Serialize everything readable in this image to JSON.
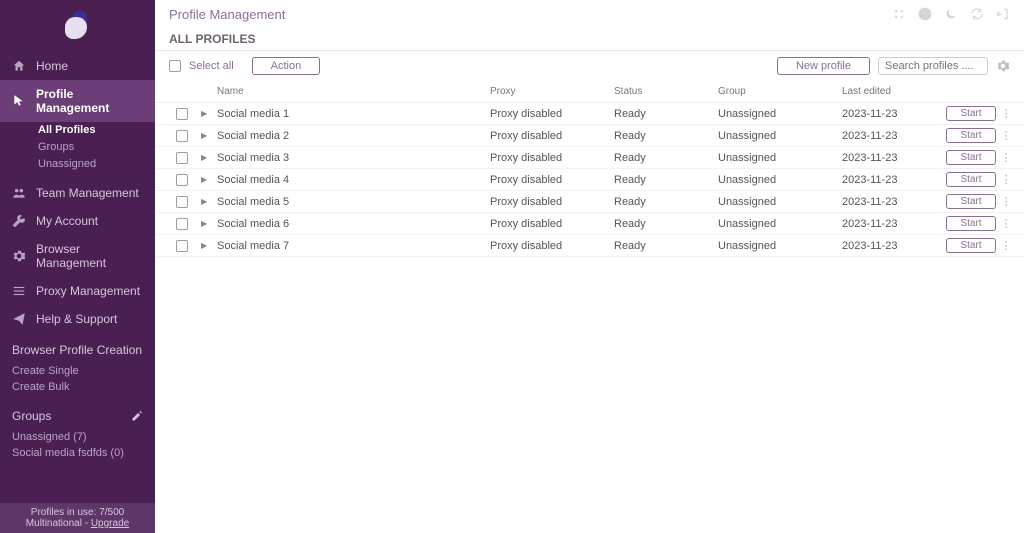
{
  "page_title": "Profile Management",
  "subheader": "ALL PROFILES",
  "toolbar": {
    "select_all": "Select all",
    "action": "Action",
    "new_profile": "New profile",
    "search_placeholder": "Search profiles ...."
  },
  "columns": {
    "name": "Name",
    "proxy": "Proxy",
    "status": "Status",
    "group": "Group",
    "last_edited": "Last edited"
  },
  "rows": [
    {
      "name": "Social media 1",
      "proxy": "Proxy disabled",
      "status": "Ready",
      "group": "Unassigned",
      "last_edited": "2023-11-23",
      "action": "Start"
    },
    {
      "name": "Social media 2",
      "proxy": "Proxy disabled",
      "status": "Ready",
      "group": "Unassigned",
      "last_edited": "2023-11-23",
      "action": "Start"
    },
    {
      "name": "Social media 3",
      "proxy": "Proxy disabled",
      "status": "Ready",
      "group": "Unassigned",
      "last_edited": "2023-11-23",
      "action": "Start"
    },
    {
      "name": "Social media 4",
      "proxy": "Proxy disabled",
      "status": "Ready",
      "group": "Unassigned",
      "last_edited": "2023-11-23",
      "action": "Start"
    },
    {
      "name": "Social media 5",
      "proxy": "Proxy disabled",
      "status": "Ready",
      "group": "Unassigned",
      "last_edited": "2023-11-23",
      "action": "Start"
    },
    {
      "name": "Social media 6",
      "proxy": "Proxy disabled",
      "status": "Ready",
      "group": "Unassigned",
      "last_edited": "2023-11-23",
      "action": "Start"
    },
    {
      "name": "Social media 7",
      "proxy": "Proxy disabled",
      "status": "Ready",
      "group": "Unassigned",
      "last_edited": "2023-11-23",
      "action": "Start"
    }
  ],
  "sidebar": {
    "nav": [
      {
        "label": "Home"
      },
      {
        "label": "Profile Management"
      },
      {
        "label": "Team Management"
      },
      {
        "label": "My Account"
      },
      {
        "label": "Browser Management"
      },
      {
        "label": "Proxy Management"
      },
      {
        "label": "Help & Support"
      }
    ],
    "profile_sub": [
      {
        "label": "All Profiles"
      },
      {
        "label": "Groups"
      },
      {
        "label": "Unassigned"
      }
    ],
    "creation_title": "Browser Profile Creation",
    "creation_links": [
      {
        "label": "Create Single"
      },
      {
        "label": "Create Bulk"
      }
    ],
    "groups_title": "Groups",
    "groups_links": [
      {
        "label": "Unassigned (7)"
      },
      {
        "label": "Social media fsdfds (0)"
      }
    ],
    "footer_line1": "Profiles in use:  7/500",
    "footer_plan": "Multinational - ",
    "footer_upgrade": "Upgrade"
  }
}
